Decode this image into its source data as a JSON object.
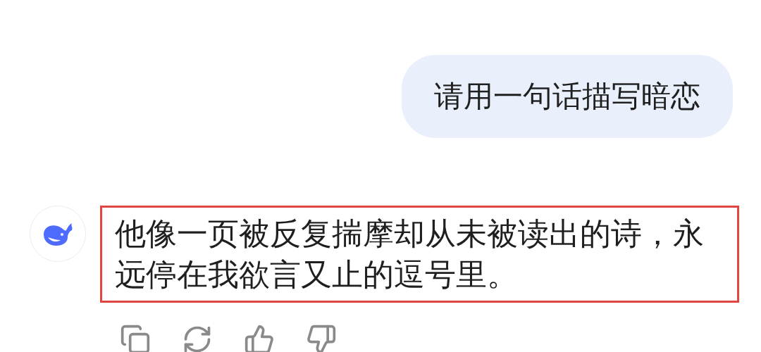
{
  "messages": [
    {
      "kind": "user",
      "text": "请用一句话描写暗恋"
    },
    {
      "kind": "reply",
      "text": "他像一页被反复揣摩却从未被读出的诗，永远停在我欲言又止的逗号里。",
      "highlighted": true
    }
  ]
}
